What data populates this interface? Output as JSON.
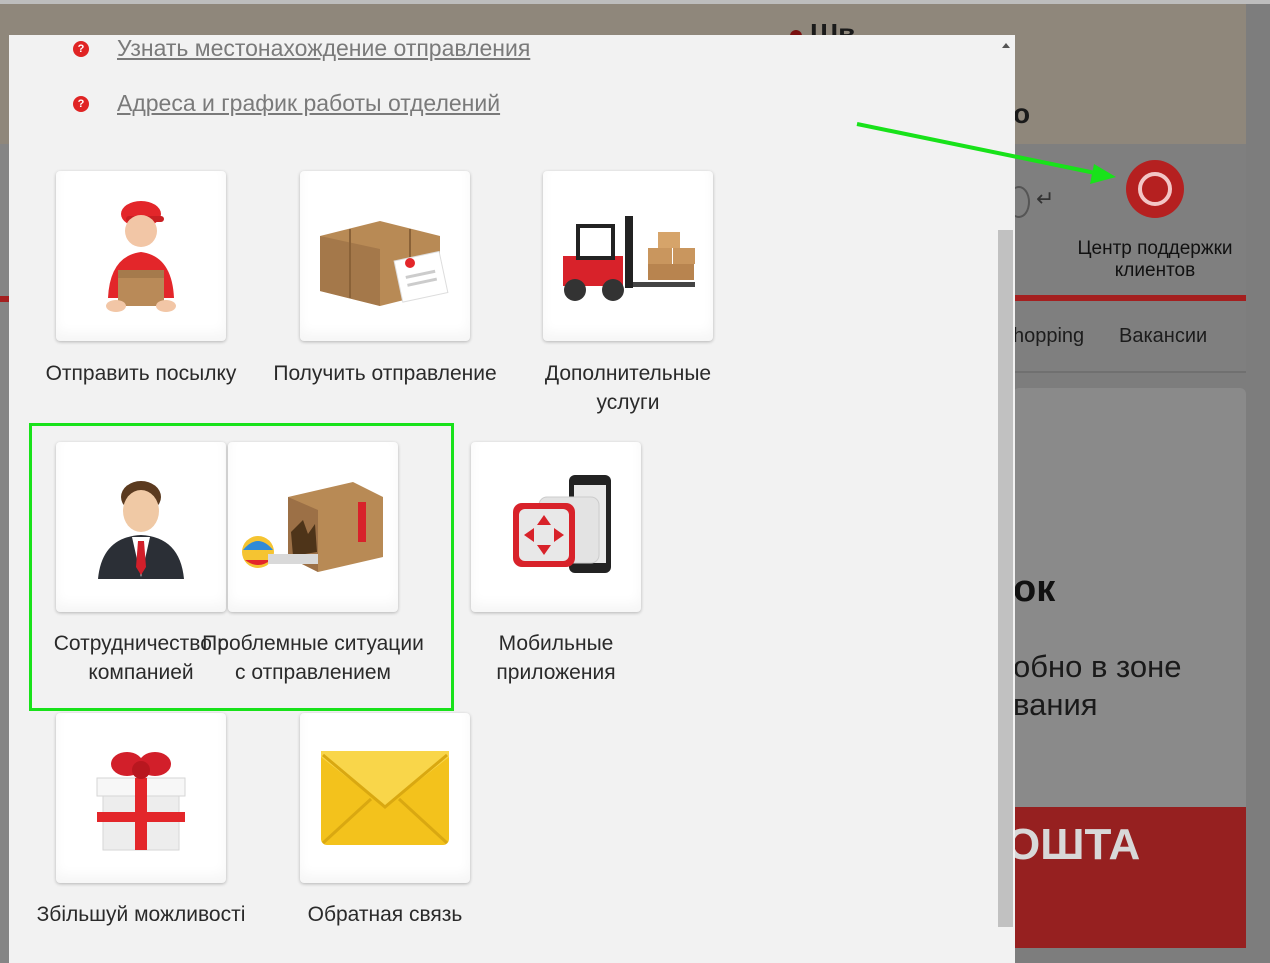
{
  "background_page": {
    "top_text_1": "Шв",
    "top_text_2": "о",
    "support": {
      "label": "Центр поддержки клиентов"
    },
    "menu": [
      "hopping",
      "Вакансии"
    ],
    "card_text_1": "ок",
    "card_text_2": "обно в зоне\nвания",
    "red_band_text": "ОШТА"
  },
  "modal": {
    "links": [
      {
        "label": "Узнать местонахождение отправления"
      },
      {
        "label": "Адреса и график работы отделений"
      }
    ],
    "tiles": [
      {
        "label": "Отправить посылку",
        "icon": "courier-with-box-icon"
      },
      {
        "label": "Получить отправление",
        "icon": "parcel-with-invoice-icon"
      },
      {
        "label": "Дополнительные услуги",
        "icon": "forklift-icon"
      },
      {
        "label": "Сотрудничество с компанией",
        "icon": "businessman-icon"
      },
      {
        "label": "Проблемные ситуации с отправлением",
        "icon": "damaged-box-icon"
      },
      {
        "label": "Мобильные приложения",
        "icon": "mobile-app-icon"
      },
      {
        "label": "Збільшуй можливості",
        "icon": "gift-icon"
      },
      {
        "label": "Обратная связь",
        "icon": "envelope-icon"
      }
    ]
  },
  "annotation_colors": {
    "highlight": "#18e21a"
  }
}
